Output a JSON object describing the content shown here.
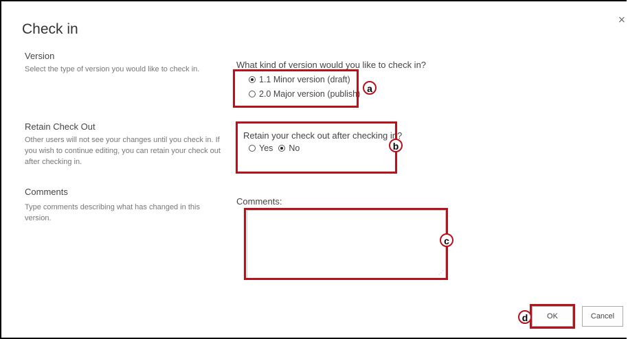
{
  "dialog": {
    "title": "Check in",
    "close_glyph": "×"
  },
  "version": {
    "title": "Version",
    "description": "Select the type of version you would like to check in.",
    "question": "What kind of version would you like to check in?",
    "options": [
      {
        "label": "1.1 Minor version (draft)",
        "selected": true
      },
      {
        "label": "2.0 Major version (publish)",
        "selected": false
      }
    ],
    "badge": "a"
  },
  "retain": {
    "title": "Retain Check Out",
    "description": "Other users will not see your changes until you check in. If you wish to continue editing, you can retain your check out after checking in.",
    "question": "Retain your check out after checking in?",
    "options": [
      {
        "label": "Yes",
        "selected": false
      },
      {
        "label": "No",
        "selected": true
      }
    ],
    "badge": "b"
  },
  "comments": {
    "title": "Comments",
    "description": "Type comments describing what has changed in this version.",
    "label": "Comments:",
    "value": "",
    "badge": "c"
  },
  "buttons": {
    "ok_label": "OK",
    "cancel_label": "Cancel",
    "badge": "d"
  },
  "colors": {
    "highlight": "#b5121b"
  }
}
